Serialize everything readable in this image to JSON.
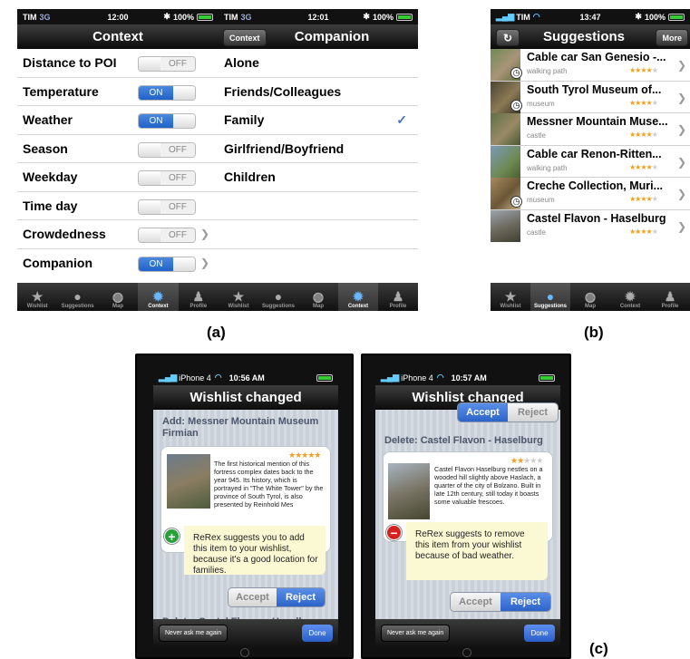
{
  "captions": {
    "a": "(a)",
    "b": "(b)",
    "c": "(c)"
  },
  "screen1": {
    "status": {
      "carrier": "TIM",
      "network": "3G",
      "time": "12:00",
      "battery": "100%"
    },
    "title": "Context",
    "rows": [
      {
        "label": "Distance to POI",
        "state": "OFF"
      },
      {
        "label": "Temperature",
        "state": "ON"
      },
      {
        "label": "Weather",
        "state": "ON"
      },
      {
        "label": "Season",
        "state": "OFF"
      },
      {
        "label": "Weekday",
        "state": "OFF"
      },
      {
        "label": "Time day",
        "state": "OFF"
      },
      {
        "label": "Crowdedness",
        "state": "OFF"
      },
      {
        "label": "Companion",
        "state": "ON"
      }
    ]
  },
  "screen2": {
    "status": {
      "carrier": "TIM",
      "network": "3G",
      "time": "12:01",
      "battery": "100%"
    },
    "back": "Context",
    "title": "Companion",
    "items": [
      "Alone",
      "Friends/Colleagues",
      "Family",
      "Girlfriend/Boyfriend",
      "Children"
    ]
  },
  "tabs": {
    "wishlist": "Wishlist",
    "suggestions": "Suggestions",
    "map": "Map",
    "context": "Context",
    "profile": "Profile"
  },
  "screen3": {
    "status": {
      "carrier": "TIM",
      "time": "13:47",
      "battery": "100%"
    },
    "title": "Suggestions",
    "refresh": "↻",
    "more": "More",
    "items": [
      {
        "title": "Cable car San Genesio -...",
        "sub": "walking path",
        "rating": 4
      },
      {
        "title": "South Tyrol Museum of...",
        "sub": "museum",
        "rating": 4
      },
      {
        "title": "Messner Mountain Muse...",
        "sub": "castle",
        "rating": 4
      },
      {
        "title": "Cable car Renon-Ritten...",
        "sub": "walking path",
        "rating": 4
      },
      {
        "title": "Creche Collection, Muri...",
        "sub": "museum",
        "rating": 4
      },
      {
        "title": "Castel Flavon - Haselburg",
        "sub": "castle",
        "rating": 4
      }
    ]
  },
  "screen4": {
    "status": {
      "device": "iPhone 4",
      "time": "10:56 AM"
    },
    "title": "Wishlist changed",
    "section": "Add:  Messner Mountain Museum Firmian",
    "description": "The first historical mention of this fortress complex dates back to the year 945. Its history, which is portrayed in \"The White Tower\" by the province of South Tyrol, is also presented by Reinhold Mes",
    "note": "ReRex suggests you to add this item to your wishlist, because it's a good location for families.",
    "accept": "Accept",
    "reject": "Reject",
    "next_section": "Delete:  Castel Flavon - Haselburg",
    "never": "Never ask me again",
    "done": "Done"
  },
  "screen5": {
    "status": {
      "device": "iPhone 4",
      "time": "10:57 AM"
    },
    "title": "Wishlist changed",
    "top_accept": "Accept",
    "top_reject": "Reject",
    "section": "Delete:  Castel Flavon - Haselburg",
    "description": "Castel Flavon Haselburg nestles on a wooded hill slightly above Haslach, a quarter of the city of Bolzano. Built in late 12th century, still today it boasts some valuable frescoes.",
    "note": "ReRex suggests to remove this item from your wishlist because of bad weather.",
    "accept": "Accept",
    "reject": "Reject",
    "never": "Never ask me again",
    "done": "Done"
  }
}
